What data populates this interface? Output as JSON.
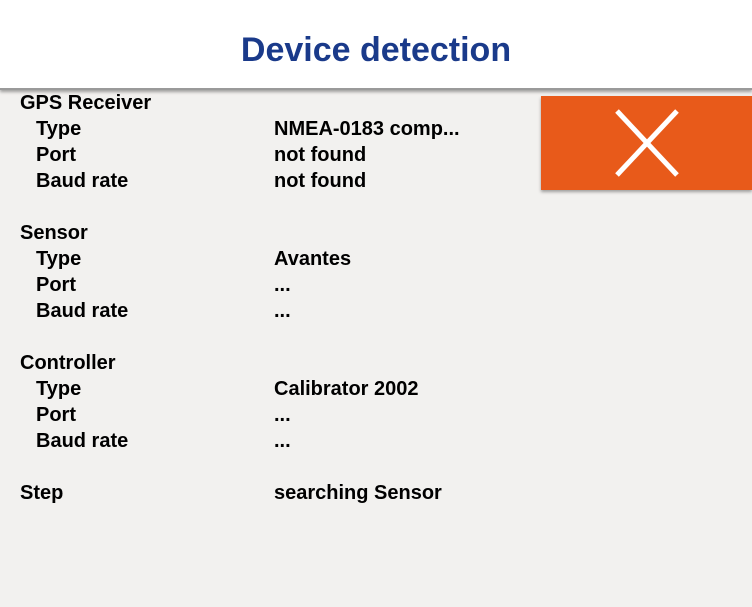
{
  "title": "Device detection",
  "colors": {
    "title": "#1a3a8a",
    "close_button": "#e85a1a"
  },
  "close_button_icon": "close-x-icon",
  "gps": {
    "heading": "GPS Receiver",
    "type_label": "Type",
    "type_value": "NMEA-0183 comp...",
    "port_label": "Port",
    "port_value": "not found",
    "baud_label": "Baud rate",
    "baud_value": "not found"
  },
  "sensor": {
    "heading": "Sensor",
    "type_label": "Type",
    "type_value": "Avantes",
    "port_label": "Port",
    "port_value": "...",
    "baud_label": "Baud rate",
    "baud_value": "..."
  },
  "controller": {
    "heading": "Controller",
    "type_label": "Type",
    "type_value": "Calibrator 2002",
    "port_label": "Port",
    "port_value": "...",
    "baud_label": "Baud rate",
    "baud_value": "..."
  },
  "step": {
    "label": "Step",
    "value": "searching Sensor"
  }
}
